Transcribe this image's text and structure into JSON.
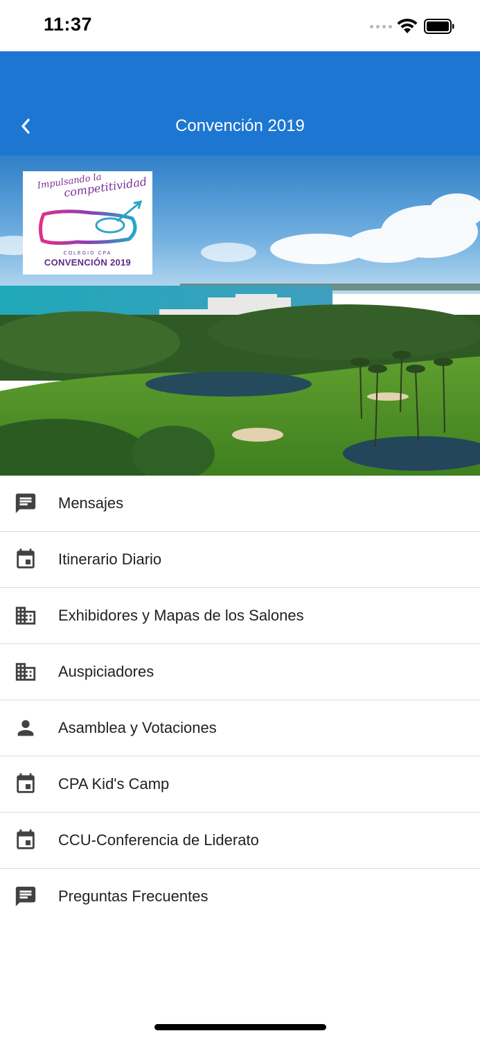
{
  "status_bar": {
    "time": "11:37"
  },
  "app_bar": {
    "title": "Convención 2019",
    "back_icon": "chevron-left-icon",
    "color": "#1d76d2"
  },
  "hero": {
    "logo": {
      "tagline_line1": "Impulsando la",
      "tagline_line2": "competitividad",
      "org": "COLEGIO CPA",
      "event": "CONVENCIÓN 2019"
    }
  },
  "menu": {
    "items": [
      {
        "label": "Mensajes",
        "icon": "message-icon"
      },
      {
        "label": "Itinerario Diario",
        "icon": "calendar-icon"
      },
      {
        "label": "Exhibidores y Mapas de los Salones",
        "icon": "building-icon"
      },
      {
        "label": "Auspiciadores",
        "icon": "building-icon"
      },
      {
        "label": "Asamblea y Votaciones",
        "icon": "person-icon"
      },
      {
        "label": "CPA Kid's Camp",
        "icon": "calendar-icon"
      },
      {
        "label": "CCU-Conferencia de Liderato",
        "icon": "calendar-icon"
      },
      {
        "label": "Preguntas Frecuentes",
        "icon": "message-icon"
      }
    ]
  }
}
